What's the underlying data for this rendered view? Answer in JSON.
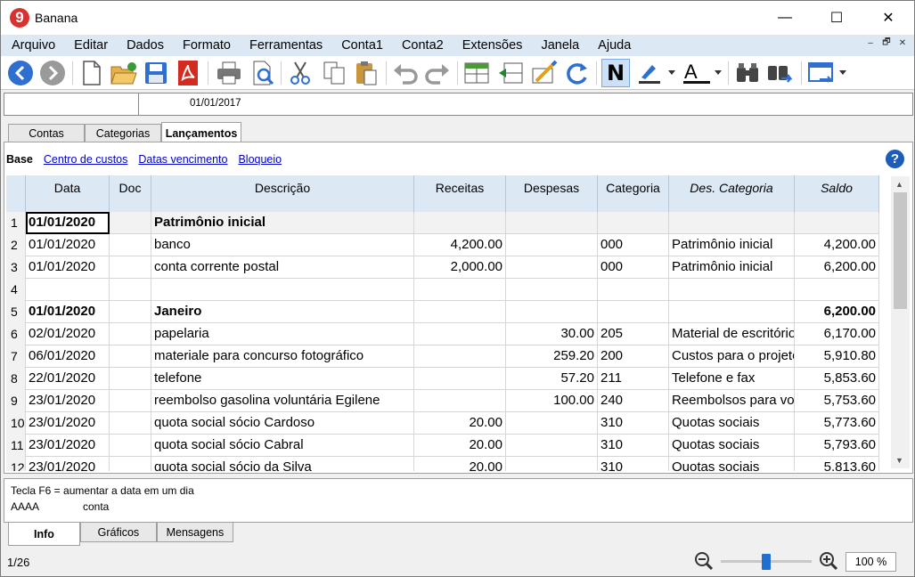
{
  "window": {
    "title": "Banana",
    "logo_text": "9",
    "minimize": "—",
    "maximize": "☐",
    "close": "✕"
  },
  "menu": [
    "Arquivo",
    "Editar",
    "Dados",
    "Formato",
    "Ferramentas",
    "Conta1",
    "Conta2",
    "Extensões",
    "Janela",
    "Ajuda"
  ],
  "mdi_controls": [
    "‒",
    "🗗",
    "✕"
  ],
  "toolbar": [
    "back-icon",
    "forward-icon",
    "new-file-icon",
    "open-file-icon",
    "save-icon",
    "pdf-icon",
    "print-icon",
    "print-preview-icon",
    "cut-icon",
    "copy-icon",
    "paste-icon",
    "undo-icon",
    "redo-icon",
    "insert-rows-icon",
    "delete-rows-icon",
    "edit-columns-icon",
    "recalculate-icon",
    "bold-icon",
    "highlight-icon",
    "text-color-icon",
    "find-icon",
    "find-next-icon",
    "window-layout-icon"
  ],
  "formula_bar": {
    "cell_ref": "",
    "value": "01/01/2017"
  },
  "tabs": [
    "Contas",
    "Categorias",
    "Lançamentos"
  ],
  "active_tab": "Lançamentos",
  "views": [
    "Base",
    "Centro de custos",
    "Datas vencimento",
    "Bloqueio"
  ],
  "table": {
    "headers": [
      "Data",
      "Doc",
      "Descrição",
      "Receitas",
      "Despesas",
      "Categoria",
      "Des. Categoria",
      "Saldo"
    ],
    "rows": [
      {
        "n": "1",
        "data": "01/01/2020",
        "doc": "",
        "desc": "Patrimônio inicial",
        "rec": "",
        "desp": "",
        "cat": "",
        "descat": "",
        "saldo": ""
      },
      {
        "n": "2",
        "data": "01/01/2020",
        "doc": "",
        "desc": "banco",
        "rec": "4,200.00",
        "desp": "",
        "cat": "000",
        "descat": "Patrimônio inicial",
        "saldo": "4,200.00"
      },
      {
        "n": "3",
        "data": "01/01/2020",
        "doc": "",
        "desc": "conta corrente postal",
        "rec": "2,000.00",
        "desp": "",
        "cat": "000",
        "descat": "Patrimônio inicial",
        "saldo": "6,200.00"
      },
      {
        "n": "4",
        "data": "",
        "doc": "",
        "desc": "",
        "rec": "",
        "desp": "",
        "cat": "",
        "descat": "",
        "saldo": ""
      },
      {
        "n": "5",
        "data": "01/01/2020",
        "doc": "",
        "desc": "Janeiro",
        "rec": "",
        "desp": "",
        "cat": "",
        "descat": "",
        "saldo": "6,200.00"
      },
      {
        "n": "6",
        "data": "02/01/2020",
        "doc": "",
        "desc": "papelaria",
        "rec": "",
        "desp": "30.00",
        "cat": "205",
        "descat": "Material de escritório",
        "saldo": "6,170.00"
      },
      {
        "n": "7",
        "data": "06/01/2020",
        "doc": "",
        "desc": "materiale para concurso fotográfico",
        "rec": "",
        "desp": "259.20",
        "cat": "200",
        "descat": "Custos para o projeto",
        "saldo": "5,910.80"
      },
      {
        "n": "8",
        "data": "22/01/2020",
        "doc": "",
        "desc": "telefone",
        "rec": "",
        "desp": "57.20",
        "cat": "211",
        "descat": "Telefone e fax",
        "saldo": "5,853.60"
      },
      {
        "n": "9",
        "data": "23/01/2020",
        "doc": "",
        "desc": "reembolso gasolina voluntária Egilene",
        "rec": "",
        "desp": "100.00",
        "cat": "240",
        "descat": "Reembolsos para voluntários",
        "saldo": "5,753.60"
      },
      {
        "n": "10",
        "data": "23/01/2020",
        "doc": "",
        "desc": "quota social sócio Cardoso",
        "rec": "20.00",
        "desp": "",
        "cat": "310",
        "descat": "Quotas sociais",
        "saldo": "5,773.60"
      },
      {
        "n": "11",
        "data": "23/01/2020",
        "doc": "",
        "desc": "quota social sócio Cabral",
        "rec": "20.00",
        "desp": "",
        "cat": "310",
        "descat": "Quotas sociais",
        "saldo": "5,793.60"
      },
      {
        "n": "12",
        "data": "23/01/2020",
        "doc": "",
        "desc": "quota social sócio da Silva",
        "rec": "20.00",
        "desp": "",
        "cat": "310",
        "descat": "Quotas sociais",
        "saldo": "5,813.60"
      }
    ]
  },
  "info": {
    "line1": "Tecla F6 = aumentar a data em um dia",
    "col_name": "AAAA",
    "col_desc": "conta"
  },
  "bottom_tabs": [
    "Info",
    "Gráficos",
    "Mensagens"
  ],
  "status": {
    "position": "1/26",
    "zoom": "100 %"
  }
}
